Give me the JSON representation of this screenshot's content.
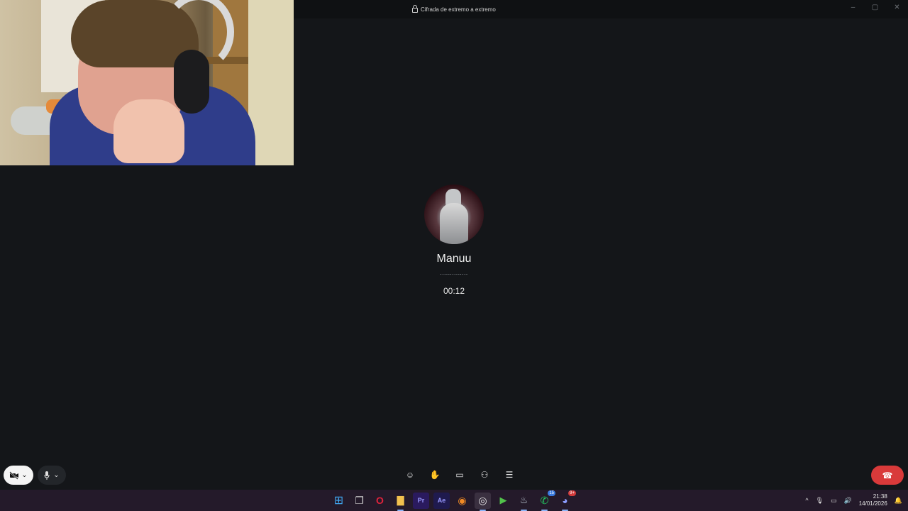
{
  "titlebar": {
    "encryption_label": "Cifrada de extremo a extremo",
    "buttons": [
      "–",
      "▢",
      "✕"
    ]
  },
  "call": {
    "contact_name": "Manuu",
    "status_dots": "..............",
    "timer": "00:12"
  },
  "controls": {
    "camera_icon": "video-off-icon",
    "mic_icon": "microphone-icon",
    "chevron": "⌄",
    "tools": [
      {
        "name": "emoji-icon",
        "glyph": "☺"
      },
      {
        "name": "raise-hand-icon",
        "glyph": "✋"
      },
      {
        "name": "share-screen-icon",
        "glyph": "▭"
      },
      {
        "name": "add-participant-icon",
        "glyph": "⚇"
      },
      {
        "name": "chat-icon",
        "glyph": "☰"
      }
    ],
    "hangup_glyph": "☎",
    "hangup_color": "#d93a3a"
  },
  "taskbar": {
    "apps": [
      {
        "name": "windows-start-icon",
        "glyph": "⊞",
        "color": "#3fa7f0"
      },
      {
        "name": "task-view-icon",
        "glyph": "❐",
        "color": "#cfcfcf"
      },
      {
        "name": "opera-icon",
        "glyph": "O",
        "color": "#e0233c"
      },
      {
        "name": "file-explorer-icon",
        "glyph": "▇",
        "color": "#f2c14e"
      },
      {
        "name": "premiere-icon",
        "glyph": "Pr",
        "color": "#9999ff"
      },
      {
        "name": "after-effects-icon",
        "glyph": "Ae",
        "color": "#9999ff"
      },
      {
        "name": "blender-icon",
        "glyph": "◉",
        "color": "#f08a24"
      },
      {
        "name": "chrome-icon",
        "glyph": "◎",
        "color": "#e8e8e8"
      },
      {
        "name": "play-icon",
        "glyph": "▶",
        "color": "#52c24b"
      },
      {
        "name": "steam-icon",
        "glyph": "♨",
        "color": "#c7d5e0"
      },
      {
        "name": "whatsapp-icon",
        "glyph": "✆",
        "color": "#25d366",
        "badge": "15"
      },
      {
        "name": "discord-icon",
        "glyph": "◕",
        "color": "#8c9eff",
        "badge": "9+"
      }
    ],
    "tray": {
      "chevron": "^",
      "mic": "🎙",
      "network": "▭",
      "volume": "🔊",
      "time": "21:38",
      "date": "14/01/2026",
      "notifications": "🔔"
    }
  }
}
